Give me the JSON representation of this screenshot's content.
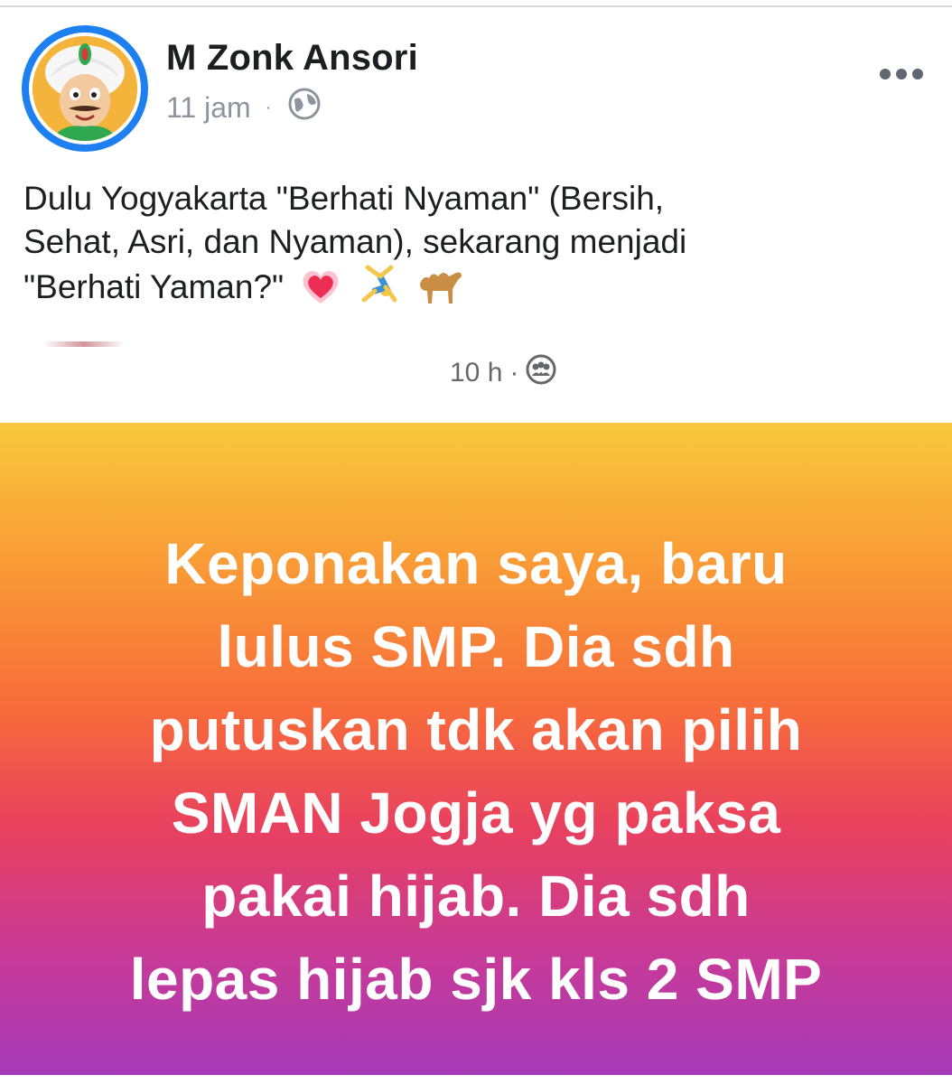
{
  "post": {
    "author": "M Zonk Ansori",
    "time": "11 jam",
    "separator": "·",
    "audience_icon": "globe-icon",
    "menu_icon": "more-options-icon",
    "caption_lines": [
      "Dulu Yogyakarta \"Berhati Nyaman\" (Bersih,",
      "Sehat, Asri, dan Nyaman), sekarang menjadi",
      "\"Berhati Yaman?\""
    ],
    "caption_emojis": [
      "growing-heart-icon",
      "cartwheel-person-icon",
      "camel-icon"
    ]
  },
  "shared": {
    "time": "10 h",
    "separator": "·",
    "audience_icon": "friends-icon",
    "lines": [
      "Keponakan saya, baru",
      "lulus SMP. Dia sdh",
      "putuskan tdk akan pilih",
      "SMAN Jogja yg paksa",
      "pakai hijab. Dia sdh",
      "lepas hijab sjk kls 2 SMP"
    ],
    "gradient_colors": [
      "#f8c93d",
      "#f99a36",
      "#f76b3b",
      "#e8405f",
      "#c73a98",
      "#a53ab8"
    ]
  },
  "colors": {
    "avatar_ring": "#1e7ff0",
    "meta_text": "#8d949e",
    "body_text": "#1c1e21"
  }
}
